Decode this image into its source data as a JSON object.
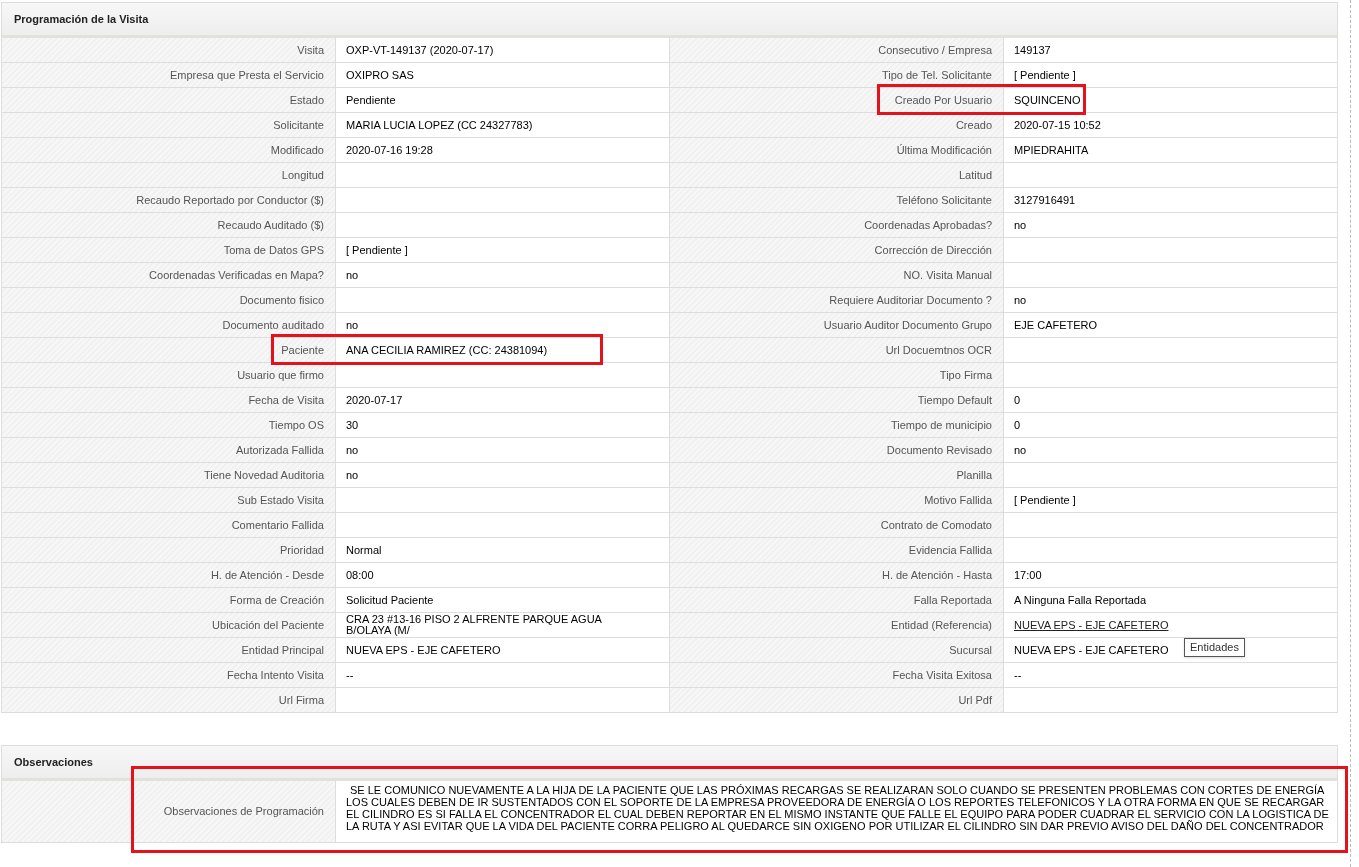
{
  "visit_section": {
    "title": "Programación de la Visita",
    "rows": [
      {
        "left": {
          "label": "Visita",
          "value": "OXP-VT-149137 (2020-07-17)"
        },
        "right": {
          "label": "Consecutivo / Empresa",
          "value": "149137"
        }
      },
      {
        "left": {
          "label": "Empresa que Presta el Servicio",
          "value": "OXIPRO SAS"
        },
        "right": {
          "label": "Tipo de Tel. Solicitante",
          "value": "[ Pendiente ]"
        }
      },
      {
        "left": {
          "label": "Estado",
          "value": "Pendiente"
        },
        "right": {
          "label": "Creado Por Usuario",
          "value": "SQUINCENO",
          "highlighted": true
        }
      },
      {
        "left": {
          "label": "Solicitante",
          "value": "MARIA LUCIA LOPEZ (CC 24327783)"
        },
        "right": {
          "label": "Creado",
          "value": "2020-07-15 10:52"
        }
      },
      {
        "left": {
          "label": "Modificado",
          "value": "2020-07-16 19:28"
        },
        "right": {
          "label": "Última Modificación",
          "value": "MPIEDRAHITA"
        }
      },
      {
        "left": {
          "label": "Longitud"
        },
        "right": {
          "label": "Latitud"
        }
      },
      {
        "left": {
          "label": "Recaudo Reportado por Conductor ($)"
        },
        "right": {
          "label": "Teléfono Solicitante",
          "value": "3127916491"
        }
      },
      {
        "left": {
          "label": "Recaudo Auditado ($)"
        },
        "right": {
          "label": "Coordenadas Aprobadas?",
          "value": "no"
        }
      },
      {
        "left": {
          "label": "Toma de Datos GPS",
          "value": "[ Pendiente ]"
        },
        "right": {
          "label": "Corrección de Dirección"
        }
      },
      {
        "left": {
          "label": "Coordenadas Verificadas en Mapa?",
          "value": "no"
        },
        "right": {
          "label": "NO. Visita Manual"
        }
      },
      {
        "left": {
          "label": "Documento fisico"
        },
        "right": {
          "label": "Requiere Auditoriar Documento ?",
          "value": "no"
        }
      },
      {
        "left": {
          "label": "Documento auditado",
          "value": "no"
        },
        "right": {
          "label": "Usuario Auditor Documento Grupo",
          "value": "EJE CAFETERO"
        }
      },
      {
        "left": {
          "label": "Paciente",
          "value": "ANA CECILIA RAMIREZ (CC: 24381094)",
          "highlighted": true
        },
        "right": {
          "label": "Url Docuemtnos OCR"
        }
      },
      {
        "left": {
          "label": "Usuario que firmo"
        },
        "right": {
          "label": "Tipo Firma"
        }
      },
      {
        "left": {
          "label": "Fecha de Visita",
          "value": "2020-07-17"
        },
        "right": {
          "label": "Tiempo Default",
          "value": "0"
        }
      },
      {
        "left": {
          "label": "Tiempo OS",
          "value": "30"
        },
        "right": {
          "label": "Tiempo de municipio",
          "value": "0"
        }
      },
      {
        "left": {
          "label": "Autorizada Fallida",
          "value": "no"
        },
        "right": {
          "label": "Documento Revisado",
          "value": "no"
        }
      },
      {
        "left": {
          "label": "Tiene Novedad Auditoria",
          "value": "no"
        },
        "right": {
          "label": "Planilla"
        }
      },
      {
        "left": {
          "label": "Sub Estado Visita"
        },
        "right": {
          "label": "Motivo Fallida",
          "value": "[ Pendiente ]"
        }
      },
      {
        "left": {
          "label": "Comentario Fallida"
        },
        "right": {
          "label": "Contrato de Comodato"
        }
      },
      {
        "left": {
          "label": "Prioridad",
          "value": "Normal"
        },
        "right": {
          "label": "Evidencia Fallida"
        }
      },
      {
        "left": {
          "label": "H. de Atención - Desde",
          "value": "08:00"
        },
        "right": {
          "label": "H. de Atención - Hasta",
          "value": "17:00"
        }
      },
      {
        "left": {
          "label": "Forma de Creación",
          "value": "Solicitud Paciente"
        },
        "right": {
          "label": "Falla Reportada",
          "value": "A Ninguna Falla Reportada"
        }
      },
      {
        "left": {
          "label": "Ubicación del Paciente",
          "value": "CRA 23 #13-16 PISO 2 ALFRENTE PARQUE AGUA B/OLAYA (M/"
        },
        "right": {
          "label": "Entidad (Referencia)",
          "value": "NUEVA EPS - EJE CAFETERO",
          "kind": "link"
        }
      },
      {
        "left": {
          "label": "Entidad Principal",
          "value": "NUEVA EPS - EJE CAFETERO"
        },
        "right": {
          "label": "Sucursal",
          "value": "NUEVA EPS - EJE CAFETERO",
          "tooltip": "Entidades"
        }
      },
      {
        "left": {
          "label": "Fecha Intento Visita",
          "value": "--"
        },
        "right": {
          "label": "Fecha Visita Exitosa",
          "value": "--"
        }
      },
      {
        "left": {
          "label": "Url Firma"
        },
        "right": {
          "label": "Url Pdf"
        }
      }
    ]
  },
  "observations_section": {
    "title": "Observaciones",
    "label": "Observaciones de Programación",
    "highlighted": true,
    "value": "SE LE COMUNICO NUEVAMENTE A LA HIJA DE LA PACIENTE QUE LAS PRÓXIMAS RECARGAS SE REALIZARAN SOLO CUANDO SE PRESENTEN PROBLEMAS CON CORTES DE ENERGÍA LOS CUALES DEBEN DE IR SUSTENTADOS CON EL SOPORTE DE LA EMPRESA PROVEEDORA DE ENERGÍA O LOS REPORTES TELEFONICOS Y LA OTRA FORMA EN QUE SE RECARGAR EL CILINDRO ES SI FALLA EL CONCENTRADOR EL CUAL DEBEN REPORTAR EN EL MISMO INSTANTE QUE FALLE EL EQUIPO PARA PODER CUADRAR EL SERVICIO CON LA LOGISTICA DE LA RUTA Y ASI EVITAR QUE LA VIDA DEL PACIENTE CORRA PELIGRO AL QUEDARCE SIN OXIGENO POR UTILIZAR EL CILINDRO SIN DAR PREVIO AVISO DEL DAÑO DEL CONCENTRADOR"
  }
}
